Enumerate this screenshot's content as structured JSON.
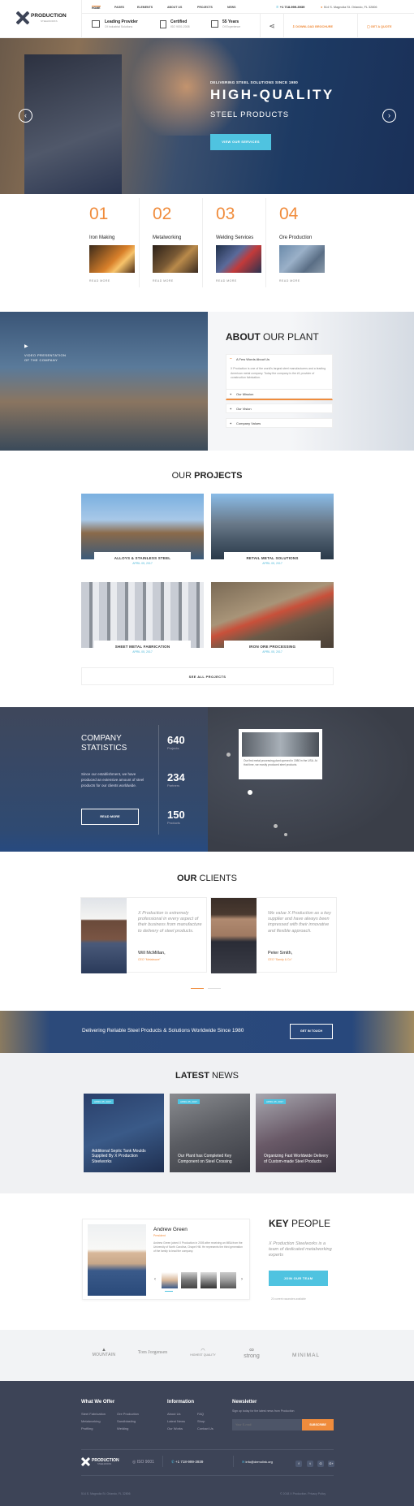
{
  "header": {
    "logo_name": "PRODUCTION",
    "logo_sub": "STEELWORKS",
    "nav": [
      "HOME",
      "PAGES",
      "ELEMENTS",
      "ABOUT US",
      "PROJECTS",
      "NEWS"
    ],
    "phone": "+1 718-999-3939",
    "address": "514 S. Magnolia St. Orlando, FL 32806",
    "features": [
      {
        "title": "Leading Provider",
        "sub": "Of Industrial Solutions"
      },
      {
        "title": "Certified",
        "sub": "ISO 9001:2008"
      },
      {
        "title": "55 Years",
        "sub": "Of Experience"
      }
    ],
    "brochure": "DOWNLOAD BROCHURE",
    "quote": "GET A QUOTE"
  },
  "hero": {
    "kicker": "DELIVERING STEEL SOLUTIONS SINCE 1980",
    "title": "HIGH-QUALITY",
    "subtitle": "STEEL PRODUCTS",
    "button": "VIEW OUR SERVICES",
    "prev": "‹",
    "next": "›"
  },
  "services": [
    {
      "num": "01",
      "title": "Iron Making",
      "more": "READ MORE"
    },
    {
      "num": "02",
      "title": "Metalworking",
      "more": "READ MORE"
    },
    {
      "num": "03",
      "title": "Welding Services",
      "more": "READ MORE"
    },
    {
      "num": "04",
      "title": "Ore Production",
      "more": "READ MORE"
    }
  ],
  "about": {
    "video_label_1": "VIDEO PRESENTATION",
    "video_label_2": "OF THE COMPANY",
    "title_bold": "ABOUT",
    "title_rest": "OUR PLANT",
    "open_item": "A Few Words About Us",
    "open_text": "X Production is one of the world's largest steel manufacturers and a leading American metal company. Today the company is the #1 provider of construction fabrication.",
    "items": [
      "Our Mission",
      "Our Vision",
      "Company Values"
    ]
  },
  "projects": {
    "title_light": "OUR",
    "title_bold": "PROJECTS",
    "items": [
      {
        "title": "ALLOYS & STAINLESS STEEL",
        "date": "APRIL 05, 2017"
      },
      {
        "title": "RETAIL METAL SOLUTIONS",
        "date": "APRIL 05, 2017"
      },
      {
        "title": "SHEET METAL FABRICATION",
        "date": "APRIL 05, 2017"
      },
      {
        "title": "IRON ORE PROCESSING",
        "date": "APRIL 05, 2017"
      }
    ],
    "see_all": "SEE ALL PROJECTS"
  },
  "stats": {
    "title1": "COMPANY",
    "title2": "STATISTICS",
    "text": "Since our establishment, we have produced an extensive amount of steel products for our clients worldwide.",
    "button": "READ MORE",
    "items": [
      {
        "n": "640",
        "l": "Projects"
      },
      {
        "n": "234",
        "l": "Partners"
      },
      {
        "n": "150",
        "l": "Products"
      }
    ],
    "map_text": "Our first metal processing plant opened in 1980 in the USA. At that time, we mostly produced steel products."
  },
  "clients": {
    "title_bold": "OUR",
    "title_light": "CLIENTS",
    "items": [
      {
        "quote": "X Production is extremely professional in every aspect of their business from manufacture to delivery of steel products.",
        "name": "Will McMillan,",
        "role": "CEO \"Metalwave\""
      },
      {
        "quote": "We value X Production as a key supplier and have always been impressed with their innovative and flexible approach.",
        "name": "Peter Smith,",
        "role": "CEO \"Sandy & Co\""
      }
    ]
  },
  "banner": {
    "text": "Delivering Reliable Steel Products & Solutions Worldwide Since 1980",
    "button": "GET IN TOUCH"
  },
  "news": {
    "title_bold": "LATEST",
    "title_light": "NEWS",
    "items": [
      {
        "date": "APRIL 05, 2017",
        "title": "Additional Septic Tank Moulds Supplied By X Production Steelworks"
      },
      {
        "date": "APRIL 05, 2017",
        "title": "Our Plant has Completed Key Component on Steel Crossing"
      },
      {
        "date": "APRIL 05, 2017",
        "title": "Organizing Fast Worldwide Delivery of Custom-made Steel Products"
      }
    ]
  },
  "people": {
    "name": "Andrew Green",
    "role": "President",
    "bio": "Andrew Green joined X Production in 2005 after receiving an MBA from the University of North Carolina, Chapel Hill. He represents the third generation of the family to lead the company.",
    "title_bold": "KEY",
    "title_light": "PEOPLE",
    "tagline": "X Production Steelworks is a team of dedicated metalworking experts",
    "button": "JOIN OUR TEAM",
    "note": "20 current vacancies available"
  },
  "logos": [
    "MOUNTAIN",
    "Tom Jorgensen",
    "HIGHEST QUALITY",
    "strong",
    "MINIMAL"
  ],
  "footer": {
    "offer_title": "What We Offer",
    "offer_col1": [
      "Steel Fabrication",
      "Metalworking",
      "Profiling"
    ],
    "offer_col2": [
      "Ore Production",
      "Sandblasting",
      "Welding"
    ],
    "info_title": "Information",
    "info_col1": [
      "About Us",
      "Latest News",
      "Our Works"
    ],
    "info_col2": [
      "FAQ",
      "Shop",
      "Contact Us"
    ],
    "news_title": "Newsletter",
    "news_text": "Sign up today for the latest news from Production",
    "email_placeholder": "Your E-mail",
    "subscribe": "SUBSCRIBE",
    "iso": "ISO 9001",
    "phone": "+1 718-999-3939",
    "email": "info@demolink.org",
    "copyright_left": "514 S. Magnolia St. Orlando, FL 32806",
    "copyright_right": "© 2018 X Production. Privacy Policy",
    "social": [
      "f",
      "t",
      "G",
      "G+"
    ]
  },
  "colors": {
    "accent_orange": "#f08c3c",
    "accent_blue": "#4fc3e0",
    "dark": "#3d4457"
  }
}
